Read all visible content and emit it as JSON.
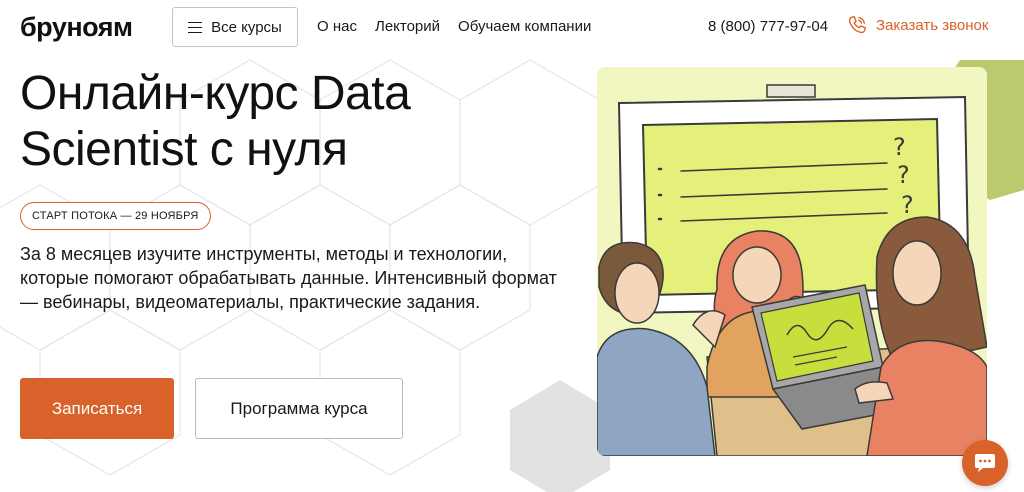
{
  "header": {
    "logo": "бруноям",
    "all_courses": "Все курсы",
    "nav": [
      "О нас",
      "Лекторий",
      "Обучаем компании"
    ],
    "phone": "8 (800) 777-97-04",
    "callback": "Заказать звонок"
  },
  "hero": {
    "title": "Онлайн-курс Data Scientist с нуля",
    "badge": "СТАРТ ПОТОКА — 29 НОЯБРЯ",
    "description": "За 8 месяцев изучите инструменты, методы и технологии, которые помогают обрабатывать данные. Интенсивный формат — вебинары, видеоматериалы, практические задания.",
    "primary_button": "Записаться",
    "secondary_button": "Программа курса"
  },
  "illustration": {
    "question_marks": [
      "?",
      "?",
      "?"
    ]
  },
  "colors": {
    "accent": "#d9622b",
    "illustration_bg": "#f2f7c2",
    "board": "#e5f07a",
    "green_side": "#b9cb6e"
  },
  "icons": {
    "menu": "burger-menu-icon",
    "phone": "phone-icon",
    "chat": "chat-bubble-icon"
  }
}
